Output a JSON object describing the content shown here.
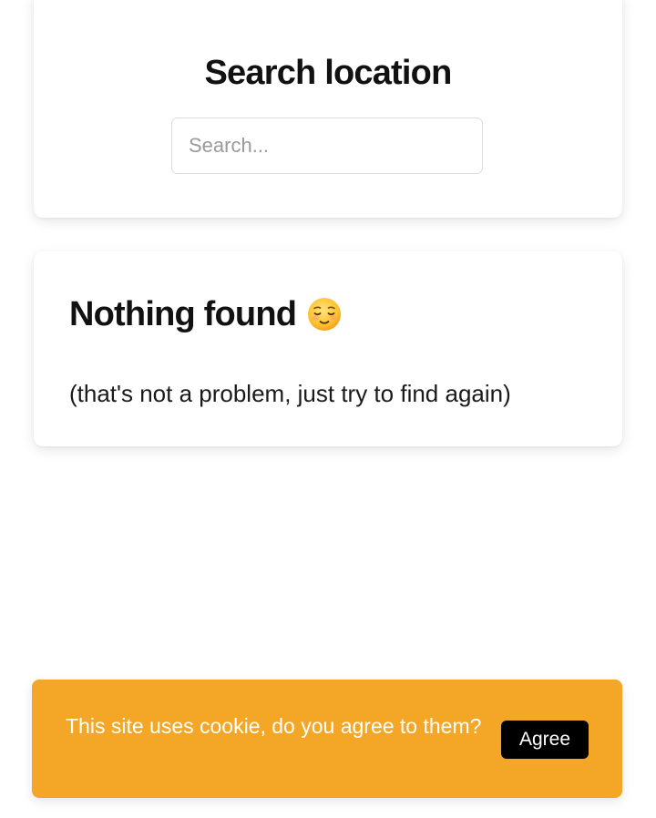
{
  "search": {
    "title": "Search location",
    "placeholder": "Search...",
    "value": ""
  },
  "result": {
    "title": "Nothing found",
    "emoji_icon": "relieved-face-icon",
    "subtitle": "(that's not a problem, just try to find again)"
  },
  "cookie": {
    "text": "This site uses cookie, do you agree to them?",
    "agree_label": "Agree",
    "background_color": "#f4a626",
    "button_color": "#000000"
  }
}
